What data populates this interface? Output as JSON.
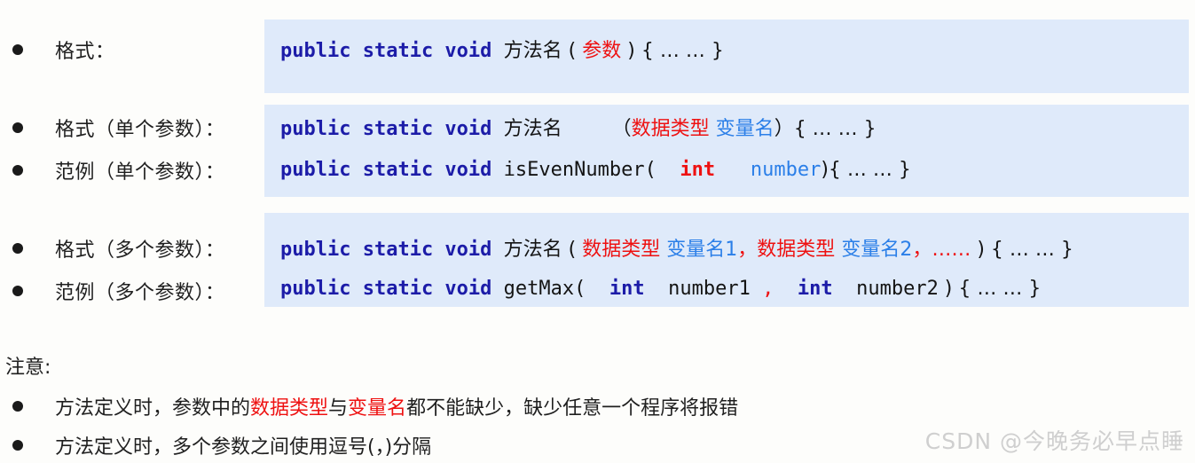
{
  "rows": [
    {
      "label": "格式："
    },
    {
      "label": "格式（单个参数）："
    },
    {
      "label": "范例（单个参数）："
    },
    {
      "label": "格式（多个参数）："
    },
    {
      "label": "范例（多个参数）："
    }
  ],
  "code": {
    "line1": {
      "kw": "public static void ",
      "method": "方法名",
      "open": " ( ",
      "param": "参数",
      "close": " ) { … … }"
    },
    "line2": {
      "kw": "public static void ",
      "method": "方法名",
      "gap": "        ",
      "open": "（",
      "type": "数据类型",
      "space": " ",
      "var": "变量名",
      "close": "）{ … … }"
    },
    "line3": {
      "kw": "public static void ",
      "method": "isEvenNumber(  ",
      "type": "int",
      "space": "   ",
      "var": "number",
      "close": "){ … … }"
    },
    "line4": {
      "kw": "public static void ",
      "method": "方法名",
      "open": " ( ",
      "type1": "数据类型",
      "sp1": " ",
      "var1": "变量名1",
      "comma1": "，",
      "type2": "数据类型",
      "sp2": " ",
      "var2": "变量名2",
      "comma2": "，",
      "ellipsis": "……",
      "close": " ) { … … }"
    },
    "line5": {
      "kw": "public static void ",
      "method": "getMax(  ",
      "type1": "int",
      "sp1": "  ",
      "var1": "number1",
      "comma": " , ",
      "type2": " int",
      "sp2": "  ",
      "var2": "number2",
      "close": " ) { … … }"
    }
  },
  "notes": {
    "title": "注意:",
    "items": [
      {
        "part1": "方法定义时，参数中的",
        "hl1": "数据类型",
        "part2": "与",
        "hl2": "变量名",
        "part3": "都不能缺少，缺少任意一个程序将报错"
      },
      {
        "part1": "方法定义时，多个参数之间使用逗号(，)分隔",
        "hl1": "",
        "part2": "",
        "hl2": "",
        "part3": ""
      }
    ]
  },
  "watermark": "CSDN @今晚务必早点睡",
  "colors": {
    "panel_bg": "#dfeafa",
    "keyword": "#1c1ca8",
    "highlight_red": "#ee1111",
    "highlight_blue": "#2b7fe8",
    "page_bg": "#fdfdfb"
  }
}
